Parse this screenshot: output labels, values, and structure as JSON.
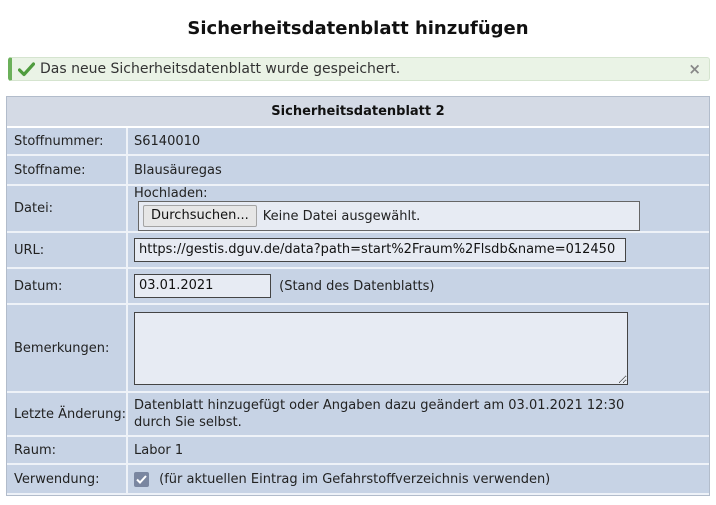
{
  "page": {
    "title": "Sicherheitsdatenblatt hinzufügen"
  },
  "alert": {
    "message": "Das neue Sicherheitsdatenblatt wurde gespeichert.",
    "icon": "check-icon",
    "close_label": "×",
    "color": "#6bb05a"
  },
  "form": {
    "heading": "Sicherheitsdatenblatt 2",
    "stoffnummer": {
      "label": "Stoffnummer:",
      "value": "S6140010"
    },
    "stoffname": {
      "label": "Stoffname:",
      "value": "Blausäuregas"
    },
    "datei": {
      "label": "Datei:",
      "upload_label": "Hochladen:",
      "button_label": "Durchsuchen...",
      "status": "Keine Datei ausgewählt."
    },
    "url": {
      "label": "URL:",
      "value": "https://gestis.dguv.de/data?path=start%2Fraum%2Flsdb&name=012450"
    },
    "datum": {
      "label": "Datum:",
      "value": "03.01.2021",
      "hint": "(Stand des Datenblatts)"
    },
    "bemerkungen": {
      "label": "Bemerkungen:",
      "value": ""
    },
    "letzte_aenderung": {
      "label": "Letzte Änderung:",
      "line1": "Datenblatt hinzugefügt oder Angaben dazu geändert am 03.01.2021 12:30",
      "line2": "durch Sie selbst."
    },
    "raum": {
      "label": "Raum:",
      "value": "Labor 1"
    },
    "verwendung": {
      "label": "Verwendung:",
      "checked": true,
      "text": "(für aktuellen Eintrag im Gefahrstoffverzeichnis verwenden)"
    }
  }
}
